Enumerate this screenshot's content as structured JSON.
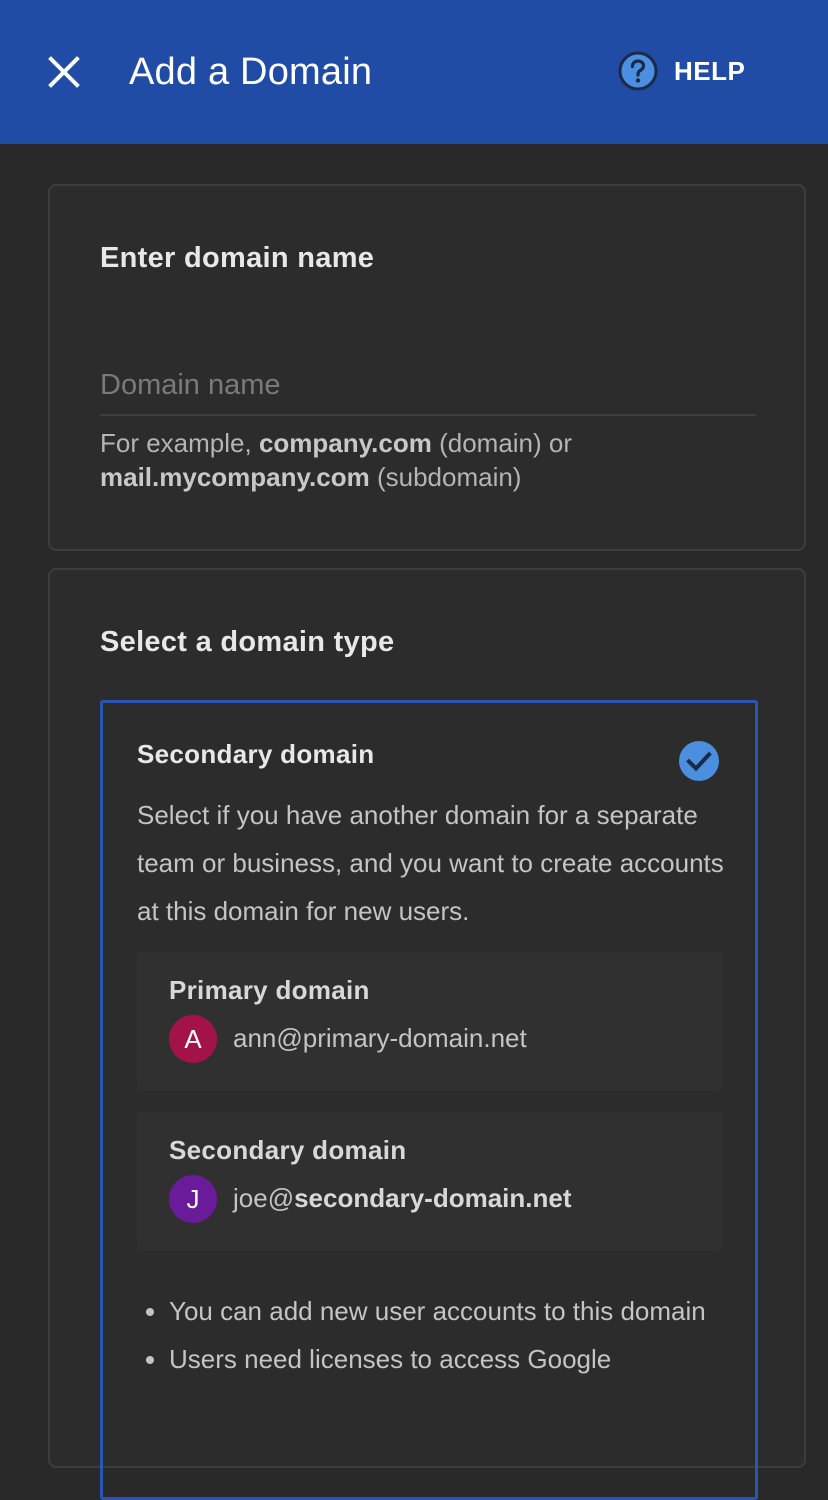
{
  "appbar": {
    "title": "Add a Domain",
    "help_label": "HELP",
    "color": "#214ca6"
  },
  "domain_card": {
    "heading": "Enter domain name",
    "input": {
      "placeholder": "Domain name",
      "value": ""
    },
    "hint": {
      "prefix": "For example, ",
      "example_domain": "company.com",
      "domain_note": " (domain) or",
      "example_subdomain": "mail.mycompany.com",
      "subdomain_note": " (subdomain)"
    }
  },
  "type_card": {
    "heading": "Select a domain type",
    "option": {
      "title": "Secondary domain",
      "selected": true,
      "description": "Select if you have another domain for a separate team or business, and you want to create accounts at this domain for new users.",
      "examples": [
        {
          "label": "Primary domain",
          "avatar_letter": "A",
          "avatar_color": "#a3134a",
          "email_user": "ann@primary-domain.net",
          "email_domain": ""
        },
        {
          "label": "Secondary domain",
          "avatar_letter": "J",
          "avatar_color": "#6a1b9a",
          "email_user": "joe@",
          "email_domain": "secondary-domain.net"
        }
      ],
      "bullets": [
        "You can add new user accounts to this domain",
        "Users need licenses to access Google"
      ]
    }
  },
  "icons": {
    "close": "close-icon",
    "help": "help-circle-icon",
    "check": "check-circle-icon"
  },
  "colors": {
    "background": "#292929",
    "accent_border": "#2a55b5",
    "check": "#4a8fe0"
  }
}
